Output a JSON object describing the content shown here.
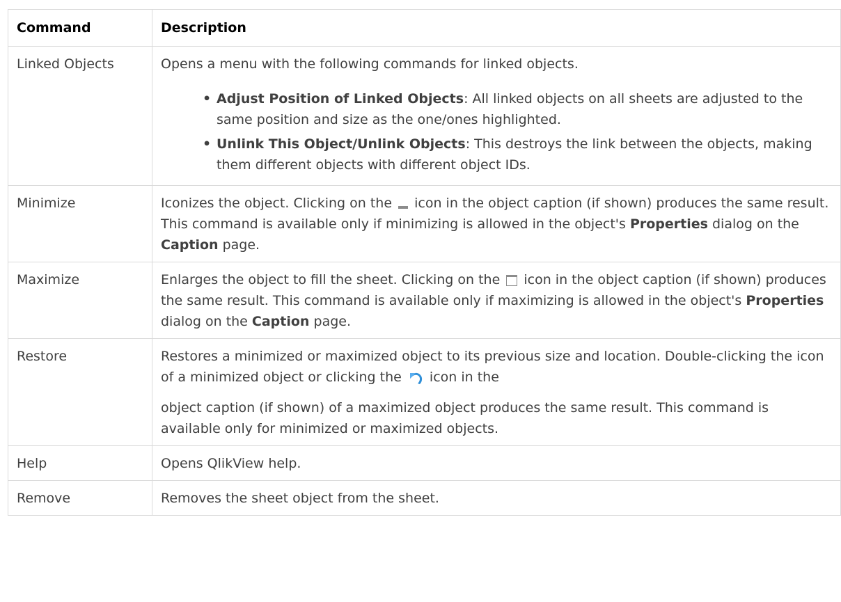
{
  "header": {
    "command": "Command",
    "description": "Description"
  },
  "rows": {
    "linked": {
      "command": "Linked Objects",
      "intro": "Opens a menu with the following commands for linked objects.",
      "items": [
        {
          "bold": "Adjust Position of Linked Objects",
          "text": ": All linked objects on all sheets are adjusted to the same position and size as the one/ones highlighted."
        },
        {
          "bold": "Unlink This Object/Unlink Objects",
          "text": ": This destroys the link between the objects, making them different objects with different object IDs."
        }
      ]
    },
    "minimize": {
      "command": "Minimize",
      "t1": "Iconizes the object. Clicking on the",
      "t2": "icon in the object caption (if shown) produces the same result. This command is available only if minimizing is allowed in the object's",
      "b1": "Properties",
      "t3": "dialog on the",
      "b2": "Caption",
      "t4": "page."
    },
    "maximize": {
      "command": "Maximize",
      "t1": "Enlarges the object to fill the sheet. Clicking on the",
      "t2": "icon in the object caption (if shown) produces the same result. This command is available only if maximizing is allowed in the object's",
      "b1": "Properties",
      "t3": "dialog on the",
      "b2": "Caption",
      "t4": "page."
    },
    "restore": {
      "command": "Restore",
      "t1": "Restores a minimized or maximized object to its previous size and location. Double-clicking the icon of a minimized object or clicking the",
      "t2": "icon in the",
      "t3": "object caption (if shown) of a maximized object produces the same result. This command is available only for minimized or maximized objects."
    },
    "help": {
      "command": "Help",
      "description": "Opens QlikView help."
    },
    "remove": {
      "command": "Remove",
      "description": "Removes the sheet object from the sheet."
    }
  },
  "icons": {
    "minimize": "minimize-icon",
    "maximize": "maximize-icon",
    "restore": "restore-icon"
  },
  "colors": {
    "text": "#404040",
    "border": "#d9d9d9",
    "icon_blue": "#2f8fd8"
  }
}
